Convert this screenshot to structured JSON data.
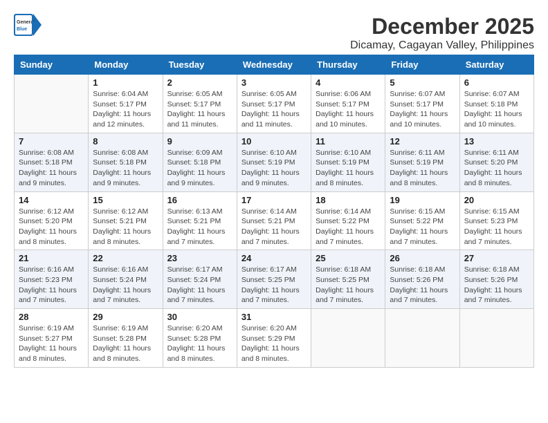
{
  "logo": {
    "general": "General",
    "blue": "Blue"
  },
  "title": "December 2025",
  "subtitle": "Dicamay, Cagayan Valley, Philippines",
  "days": [
    "Sunday",
    "Monday",
    "Tuesday",
    "Wednesday",
    "Thursday",
    "Friday",
    "Saturday"
  ],
  "weeks": [
    [
      {
        "day": "",
        "sunrise": "",
        "sunset": "",
        "daylight": ""
      },
      {
        "day": "1",
        "sunrise": "Sunrise: 6:04 AM",
        "sunset": "Sunset: 5:17 PM",
        "daylight": "Daylight: 11 hours and 12 minutes."
      },
      {
        "day": "2",
        "sunrise": "Sunrise: 6:05 AM",
        "sunset": "Sunset: 5:17 PM",
        "daylight": "Daylight: 11 hours and 11 minutes."
      },
      {
        "day": "3",
        "sunrise": "Sunrise: 6:05 AM",
        "sunset": "Sunset: 5:17 PM",
        "daylight": "Daylight: 11 hours and 11 minutes."
      },
      {
        "day": "4",
        "sunrise": "Sunrise: 6:06 AM",
        "sunset": "Sunset: 5:17 PM",
        "daylight": "Daylight: 11 hours and 10 minutes."
      },
      {
        "day": "5",
        "sunrise": "Sunrise: 6:07 AM",
        "sunset": "Sunset: 5:17 PM",
        "daylight": "Daylight: 11 hours and 10 minutes."
      },
      {
        "day": "6",
        "sunrise": "Sunrise: 6:07 AM",
        "sunset": "Sunset: 5:18 PM",
        "daylight": "Daylight: 11 hours and 10 minutes."
      }
    ],
    [
      {
        "day": "7",
        "sunrise": "Sunrise: 6:08 AM",
        "sunset": "Sunset: 5:18 PM",
        "daylight": "Daylight: 11 hours and 9 minutes."
      },
      {
        "day": "8",
        "sunrise": "Sunrise: 6:08 AM",
        "sunset": "Sunset: 5:18 PM",
        "daylight": "Daylight: 11 hours and 9 minutes."
      },
      {
        "day": "9",
        "sunrise": "Sunrise: 6:09 AM",
        "sunset": "Sunset: 5:18 PM",
        "daylight": "Daylight: 11 hours and 9 minutes."
      },
      {
        "day": "10",
        "sunrise": "Sunrise: 6:10 AM",
        "sunset": "Sunset: 5:19 PM",
        "daylight": "Daylight: 11 hours and 9 minutes."
      },
      {
        "day": "11",
        "sunrise": "Sunrise: 6:10 AM",
        "sunset": "Sunset: 5:19 PM",
        "daylight": "Daylight: 11 hours and 8 minutes."
      },
      {
        "day": "12",
        "sunrise": "Sunrise: 6:11 AM",
        "sunset": "Sunset: 5:19 PM",
        "daylight": "Daylight: 11 hours and 8 minutes."
      },
      {
        "day": "13",
        "sunrise": "Sunrise: 6:11 AM",
        "sunset": "Sunset: 5:20 PM",
        "daylight": "Daylight: 11 hours and 8 minutes."
      }
    ],
    [
      {
        "day": "14",
        "sunrise": "Sunrise: 6:12 AM",
        "sunset": "Sunset: 5:20 PM",
        "daylight": "Daylight: 11 hours and 8 minutes."
      },
      {
        "day": "15",
        "sunrise": "Sunrise: 6:12 AM",
        "sunset": "Sunset: 5:21 PM",
        "daylight": "Daylight: 11 hours and 8 minutes."
      },
      {
        "day": "16",
        "sunrise": "Sunrise: 6:13 AM",
        "sunset": "Sunset: 5:21 PM",
        "daylight": "Daylight: 11 hours and 7 minutes."
      },
      {
        "day": "17",
        "sunrise": "Sunrise: 6:14 AM",
        "sunset": "Sunset: 5:21 PM",
        "daylight": "Daylight: 11 hours and 7 minutes."
      },
      {
        "day": "18",
        "sunrise": "Sunrise: 6:14 AM",
        "sunset": "Sunset: 5:22 PM",
        "daylight": "Daylight: 11 hours and 7 minutes."
      },
      {
        "day": "19",
        "sunrise": "Sunrise: 6:15 AM",
        "sunset": "Sunset: 5:22 PM",
        "daylight": "Daylight: 11 hours and 7 minutes."
      },
      {
        "day": "20",
        "sunrise": "Sunrise: 6:15 AM",
        "sunset": "Sunset: 5:23 PM",
        "daylight": "Daylight: 11 hours and 7 minutes."
      }
    ],
    [
      {
        "day": "21",
        "sunrise": "Sunrise: 6:16 AM",
        "sunset": "Sunset: 5:23 PM",
        "daylight": "Daylight: 11 hours and 7 minutes."
      },
      {
        "day": "22",
        "sunrise": "Sunrise: 6:16 AM",
        "sunset": "Sunset: 5:24 PM",
        "daylight": "Daylight: 11 hours and 7 minutes."
      },
      {
        "day": "23",
        "sunrise": "Sunrise: 6:17 AM",
        "sunset": "Sunset: 5:24 PM",
        "daylight": "Daylight: 11 hours and 7 minutes."
      },
      {
        "day": "24",
        "sunrise": "Sunrise: 6:17 AM",
        "sunset": "Sunset: 5:25 PM",
        "daylight": "Daylight: 11 hours and 7 minutes."
      },
      {
        "day": "25",
        "sunrise": "Sunrise: 6:18 AM",
        "sunset": "Sunset: 5:25 PM",
        "daylight": "Daylight: 11 hours and 7 minutes."
      },
      {
        "day": "26",
        "sunrise": "Sunrise: 6:18 AM",
        "sunset": "Sunset: 5:26 PM",
        "daylight": "Daylight: 11 hours and 7 minutes."
      },
      {
        "day": "27",
        "sunrise": "Sunrise: 6:18 AM",
        "sunset": "Sunset: 5:26 PM",
        "daylight": "Daylight: 11 hours and 7 minutes."
      }
    ],
    [
      {
        "day": "28",
        "sunrise": "Sunrise: 6:19 AM",
        "sunset": "Sunset: 5:27 PM",
        "daylight": "Daylight: 11 hours and 8 minutes."
      },
      {
        "day": "29",
        "sunrise": "Sunrise: 6:19 AM",
        "sunset": "Sunset: 5:28 PM",
        "daylight": "Daylight: 11 hours and 8 minutes."
      },
      {
        "day": "30",
        "sunrise": "Sunrise: 6:20 AM",
        "sunset": "Sunset: 5:28 PM",
        "daylight": "Daylight: 11 hours and 8 minutes."
      },
      {
        "day": "31",
        "sunrise": "Sunrise: 6:20 AM",
        "sunset": "Sunset: 5:29 PM",
        "daylight": "Daylight: 11 hours and 8 minutes."
      },
      {
        "day": "",
        "sunrise": "",
        "sunset": "",
        "daylight": ""
      },
      {
        "day": "",
        "sunrise": "",
        "sunset": "",
        "daylight": ""
      },
      {
        "day": "",
        "sunrise": "",
        "sunset": "",
        "daylight": ""
      }
    ]
  ]
}
